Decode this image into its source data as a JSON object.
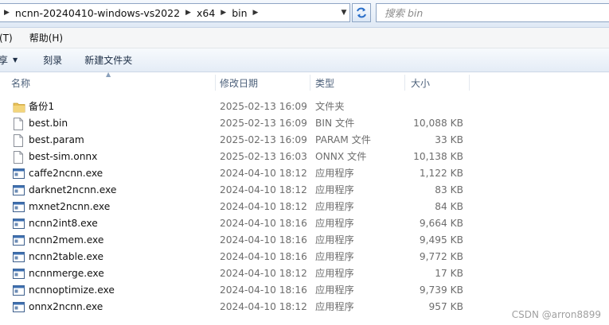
{
  "address": {
    "crumbs": [
      "ncnn-20240410-windows-vs2022",
      "x64",
      "bin"
    ]
  },
  "search": {
    "placeholder": "搜索 bin"
  },
  "menu": {
    "tools_partial": "(T)",
    "help": "帮助(H)"
  },
  "toolbar": {
    "share_partial": "共享",
    "burn": "刻录",
    "new_folder": "新建文件夹"
  },
  "columns": {
    "name": "名称",
    "date": "修改日期",
    "type": "类型",
    "size": "大小"
  },
  "files": [
    {
      "name": "备份1",
      "date": "2025-02-13 16:09",
      "type": "文件夹",
      "size": "",
      "icon": "folder-icon"
    },
    {
      "name": "best.bin",
      "date": "2025-02-13 16:09",
      "type": "BIN 文件",
      "size": "10,088 KB",
      "icon": "file-icon"
    },
    {
      "name": "best.param",
      "date": "2025-02-13 16:09",
      "type": "PARAM 文件",
      "size": "33 KB",
      "icon": "file-icon"
    },
    {
      "name": "best-sim.onnx",
      "date": "2025-02-13 16:03",
      "type": "ONNX 文件",
      "size": "10,138 KB",
      "icon": "file-icon"
    },
    {
      "name": "caffe2ncnn.exe",
      "date": "2024-04-10 18:12",
      "type": "应用程序",
      "size": "1,122 KB",
      "icon": "exe-icon"
    },
    {
      "name": "darknet2ncnn.exe",
      "date": "2024-04-10 18:12",
      "type": "应用程序",
      "size": "83 KB",
      "icon": "exe-icon"
    },
    {
      "name": "mxnet2ncnn.exe",
      "date": "2024-04-10 18:12",
      "type": "应用程序",
      "size": "84 KB",
      "icon": "exe-icon"
    },
    {
      "name": "ncnn2int8.exe",
      "date": "2024-04-10 18:16",
      "type": "应用程序",
      "size": "9,664 KB",
      "icon": "exe-icon"
    },
    {
      "name": "ncnn2mem.exe",
      "date": "2024-04-10 18:16",
      "type": "应用程序",
      "size": "9,495 KB",
      "icon": "exe-icon"
    },
    {
      "name": "ncnn2table.exe",
      "date": "2024-04-10 18:16",
      "type": "应用程序",
      "size": "9,772 KB",
      "icon": "exe-icon"
    },
    {
      "name": "ncnnmerge.exe",
      "date": "2024-04-10 18:12",
      "type": "应用程序",
      "size": "17 KB",
      "icon": "exe-icon"
    },
    {
      "name": "ncnnoptimize.exe",
      "date": "2024-04-10 18:16",
      "type": "应用程序",
      "size": "9,739 KB",
      "icon": "exe-icon"
    },
    {
      "name": "onnx2ncnn.exe",
      "date": "2024-04-10 18:12",
      "type": "应用程序",
      "size": "957 KB",
      "icon": "exe-icon"
    }
  ],
  "watermark": "CSDN @arron8899"
}
